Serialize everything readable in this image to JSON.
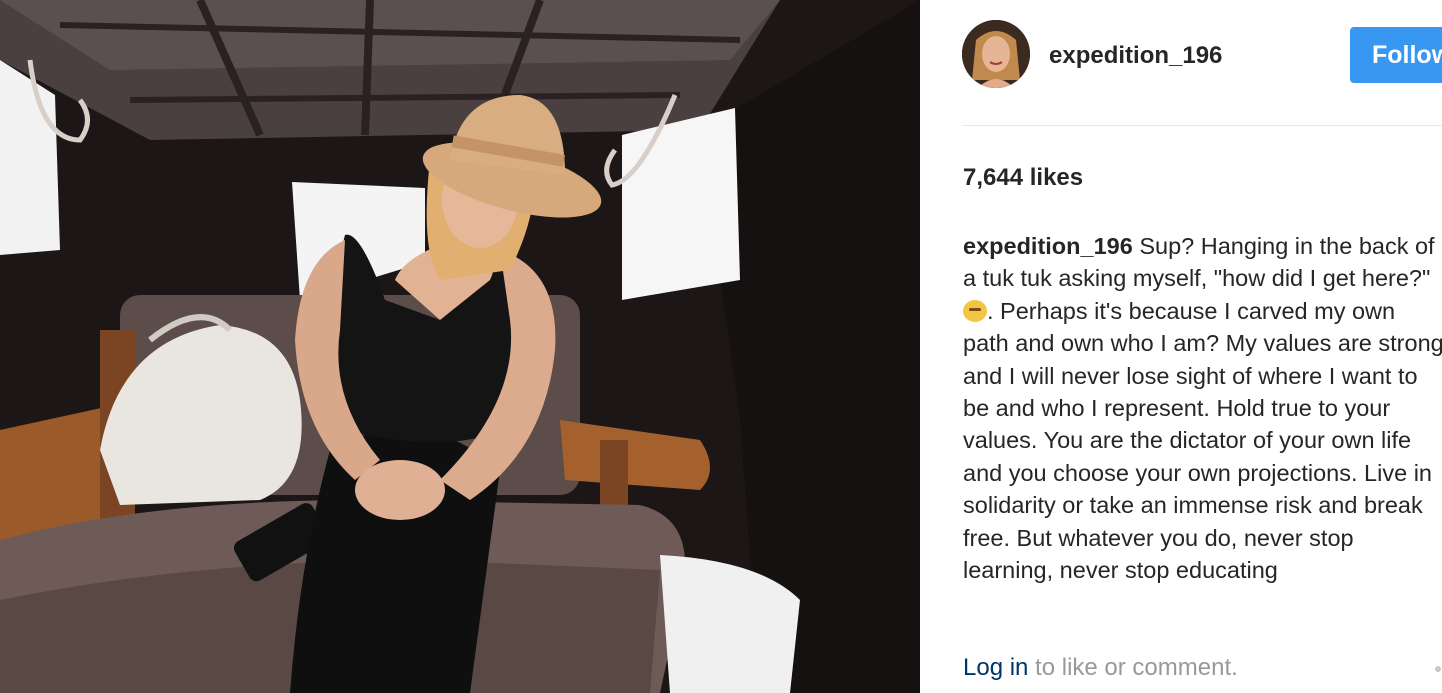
{
  "post": {
    "username": "expedition_196",
    "follow_label": "Follow",
    "likes": "7,644 likes",
    "caption": {
      "username": "expedition_196",
      "text_before_emoji": " Sup? Hanging in the back of a tuk tuk asking myself, \"how did I get here?\" ",
      "emoji": "thinking-face-icon",
      "text_after_emoji": ". Perhaps it's because I carved my own path and own who I am? My values are strong and I will never lose sight of where I want to be and who I represent. Hold true to your values. You are the dictator of your own life and you choose your own projections. Live in solidarity or take an immense risk and break free. But whatever you do, never stop learning, never stop educating"
    },
    "footer": {
      "login_link": "Log in",
      "login_suffix": " to like or comment."
    }
  },
  "colors": {
    "follow_button": "#3897f0",
    "link": "#003569",
    "muted_text": "#999999",
    "text": "#262626"
  }
}
